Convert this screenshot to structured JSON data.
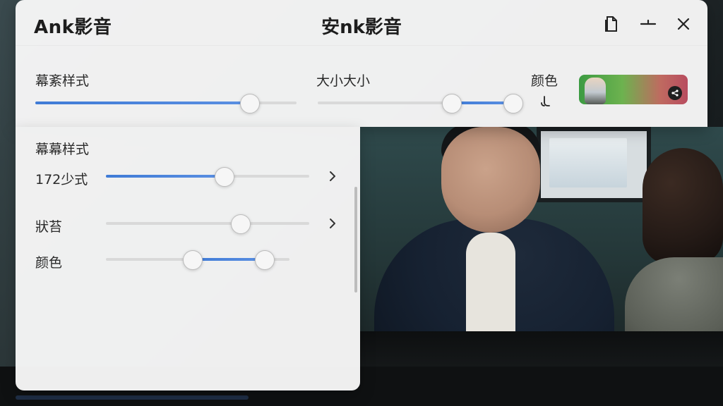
{
  "app": {
    "logo": "Ank影音",
    "center_title": "安nk影音"
  },
  "window_controls": {
    "icons": [
      "document-icon",
      "minimize-icon",
      "close-icon"
    ]
  },
  "top_controls": {
    "style_label": "幕紊样式",
    "size_label": "大小大小",
    "color_label": "颜色",
    "style_value": 0.82,
    "size_range": [
      0.65,
      0.95
    ]
  },
  "panel": {
    "title": "幕幕样式",
    "rows": [
      {
        "label": "172少式",
        "value": 0.58,
        "has_chevron": true
      },
      {
        "label": "狀苔",
        "value": 0.66,
        "has_chevron": true
      },
      {
        "label": "颜色",
        "range": [
          0.47,
          0.86
        ],
        "has_chevron": false
      }
    ]
  },
  "colors": {
    "accent": "#3f7bd6",
    "panel_bg": "#f8f8f8",
    "text": "#2a2a2a"
  }
}
